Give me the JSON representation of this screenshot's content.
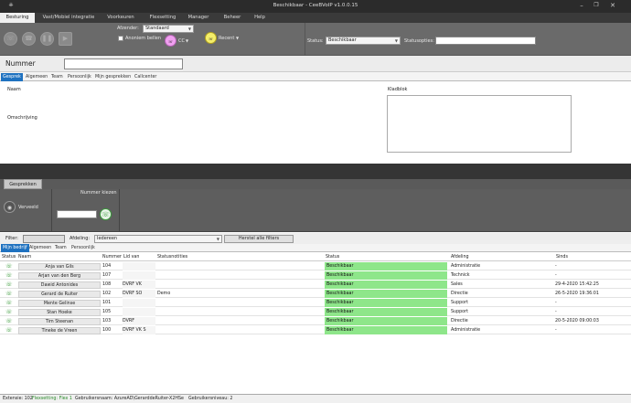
{
  "window": {
    "title": "Beschikbaar - CeeBVoIP v1.0.0.15"
  },
  "menu": [
    "Besturing",
    "Vast/Mobiel integratie",
    "Voorkeuren",
    "Flexsetting",
    "Manager",
    "Beheer",
    "Help"
  ],
  "toolbar": {
    "afzender_label": "Afzender:",
    "afzender_value": "Standaard",
    "anoniem_label": "Anoniem bellen",
    "cc_label": "CC",
    "recent_label": "Recent",
    "status_label": "Status:",
    "status_value": "Beschikbaar",
    "statusopties_label": "Statusopties:"
  },
  "nummer": {
    "label": "Nummer"
  },
  "tabs1": [
    "Gesprek",
    "Algemeen",
    "Team",
    "Persoonlijk",
    "Mijn gesprekken",
    "Callcenter"
  ],
  "detail": {
    "naam_label": "Naam",
    "omschrijving_label": "Omschrijving",
    "kladblok_label": "Kladblok"
  },
  "gesprekken": {
    "tab_label": "Gesprekken",
    "doorverbinden_label": "Verveeld",
    "nummer_kiezen_label": "Nummer kiezen"
  },
  "filter": {
    "filter_label": "Filter:",
    "afdeling_label": "Afdeling:",
    "afdeling_value": "Iedereen",
    "reset_label": "Herstel alle filters"
  },
  "tabs2": [
    "Mijn bedrijf",
    "Algemeen",
    "Team",
    "Persoonlijk"
  ],
  "table": {
    "headers": [
      "Status",
      "Naam",
      "Nummer",
      "Lid van",
      "Statusnotities",
      "Status",
      "Afdeling",
      "Sinds"
    ],
    "rows": [
      {
        "naam": "Anja van Gils",
        "nummer": "104",
        "lid": "",
        "notes": "",
        "status": "Beschikbaar",
        "afdeling": "Administratie",
        "sinds": "-"
      },
      {
        "naam": "Arjan van den Berg",
        "nummer": "107",
        "lid": "",
        "notes": "",
        "status": "Beschikbaar",
        "afdeling": "Technick",
        "sinds": "-"
      },
      {
        "naam": "Dawid Antonides",
        "nummer": "108",
        "lid": "DVRF VK",
        "notes": "",
        "status": "Beschikbaar",
        "afdeling": "Sales",
        "sinds": "29-4-2020 15:42:25"
      },
      {
        "naam": "Gerard de Ruiter",
        "nummer": "102",
        "lid": "DVRF SO",
        "notes": "Demo",
        "status": "Beschikbaar",
        "afdeling": "Directie",
        "sinds": "26-5-2020 19:36:01"
      },
      {
        "naam": "Mente Gelinse",
        "nummer": "101",
        "lid": "",
        "notes": "",
        "status": "Beschikbaar",
        "afdeling": "Support",
        "sinds": "-"
      },
      {
        "naam": "Stan Hoeke",
        "nummer": "105",
        "lid": "",
        "notes": "",
        "status": "Beschikbaar",
        "afdeling": "Support",
        "sinds": "-"
      },
      {
        "naam": "Tim Steenan",
        "nummer": "103",
        "lid": "DVRF",
        "notes": "",
        "status": "Beschikbaar",
        "afdeling": "Directie",
        "sinds": "20-5-2020 09:00:03"
      },
      {
        "naam": "Tineke de Vreen",
        "nummer": "100",
        "lid": "DVRF VK S",
        "notes": "",
        "status": "Beschikbaar",
        "afdeling": "Administratie",
        "sinds": "-"
      }
    ]
  },
  "statusbar": {
    "extensie": "Extensie: 102",
    "flexsetting": "Flexsetting: Flex 1",
    "gebruikersnaam": "Gebruikersnaam: AzureAD\\GerarddeRuiter-X2HSe",
    "gebruikersniveau": "Gebruikersniveau: 2"
  },
  "colors": {
    "status_green": "#8ee68a",
    "selected_tab": "#1f72c0",
    "pink_button": "#f0a0f0",
    "yellow_button": "#f4ee6a"
  }
}
